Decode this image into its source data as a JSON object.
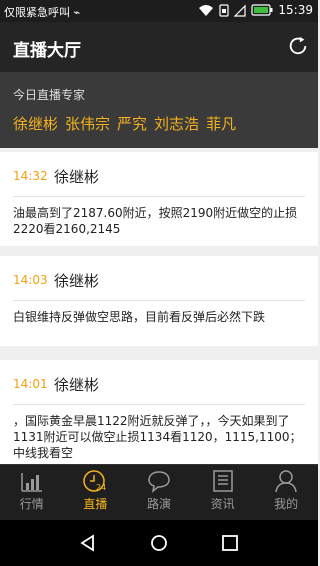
{
  "status": {
    "carrier": "仅限紧急呼叫",
    "time": "15:39",
    "icons": [
      "usb-icon",
      "wifi-icon",
      "sim-icon",
      "signal-icon",
      "battery-icon"
    ]
  },
  "header": {
    "title": "直播大厅"
  },
  "experts": {
    "label": "今日直播专家",
    "names": [
      "徐继彬",
      "张伟宗",
      "严究",
      "刘志浩",
      "菲凡"
    ]
  },
  "feed": [
    {
      "time": "14:32",
      "author": "徐继彬",
      "text": "油最高到了2187.60附近，按照2190附近做空的止损2220看2160,2145"
    },
    {
      "time": "14:03",
      "author": "徐继彬",
      "text": "白银维持反弹做空思路，目前看反弹后必然下跌"
    },
    {
      "time": "14:01",
      "author": "徐继彬",
      "text": "，国际黄金早晨1122附近就反弹了，，今天如果到了1131附近可以做空止损1134看1120，1115,1100；中线我看空"
    }
  ],
  "tabs": [
    {
      "label": "行情",
      "icon": "market-chart-icon",
      "active": false
    },
    {
      "label": "直播",
      "icon": "live-clock-icon",
      "active": true
    },
    {
      "label": "路演",
      "icon": "chat-bubble-icon",
      "active": false
    },
    {
      "label": "资讯",
      "icon": "news-icon",
      "active": false
    },
    {
      "label": "我的",
      "icon": "profile-icon",
      "active": false
    }
  ],
  "colors": {
    "accent": "#f5b21e",
    "time": "#f0a010"
  }
}
